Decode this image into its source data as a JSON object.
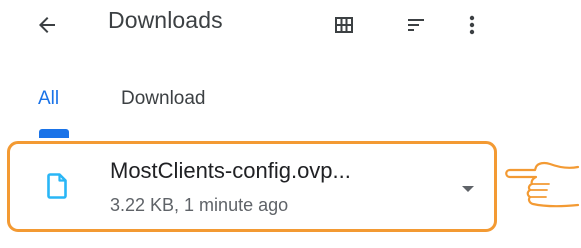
{
  "header": {
    "title": "Downloads",
    "back_icon": "arrow-left-icon",
    "view_icon": "grid-view-icon",
    "sort_icon": "sort-icon",
    "more_icon": "more-vert-icon"
  },
  "tabs": [
    {
      "label": "All",
      "selected": true
    },
    {
      "label": "Download",
      "selected": false
    }
  ],
  "file": {
    "name": "MostClients-config.ovp...",
    "meta": "3.22 KB, 1 minute ago",
    "icon": "document-icon",
    "expand_icon": "chevron-down-icon"
  },
  "annotation": {
    "icon": "pointing-hand-icon",
    "highlight_color": "#f39a33"
  },
  "colors": {
    "accent": "#1a73e8",
    "file_icon": "#29b6f6"
  }
}
